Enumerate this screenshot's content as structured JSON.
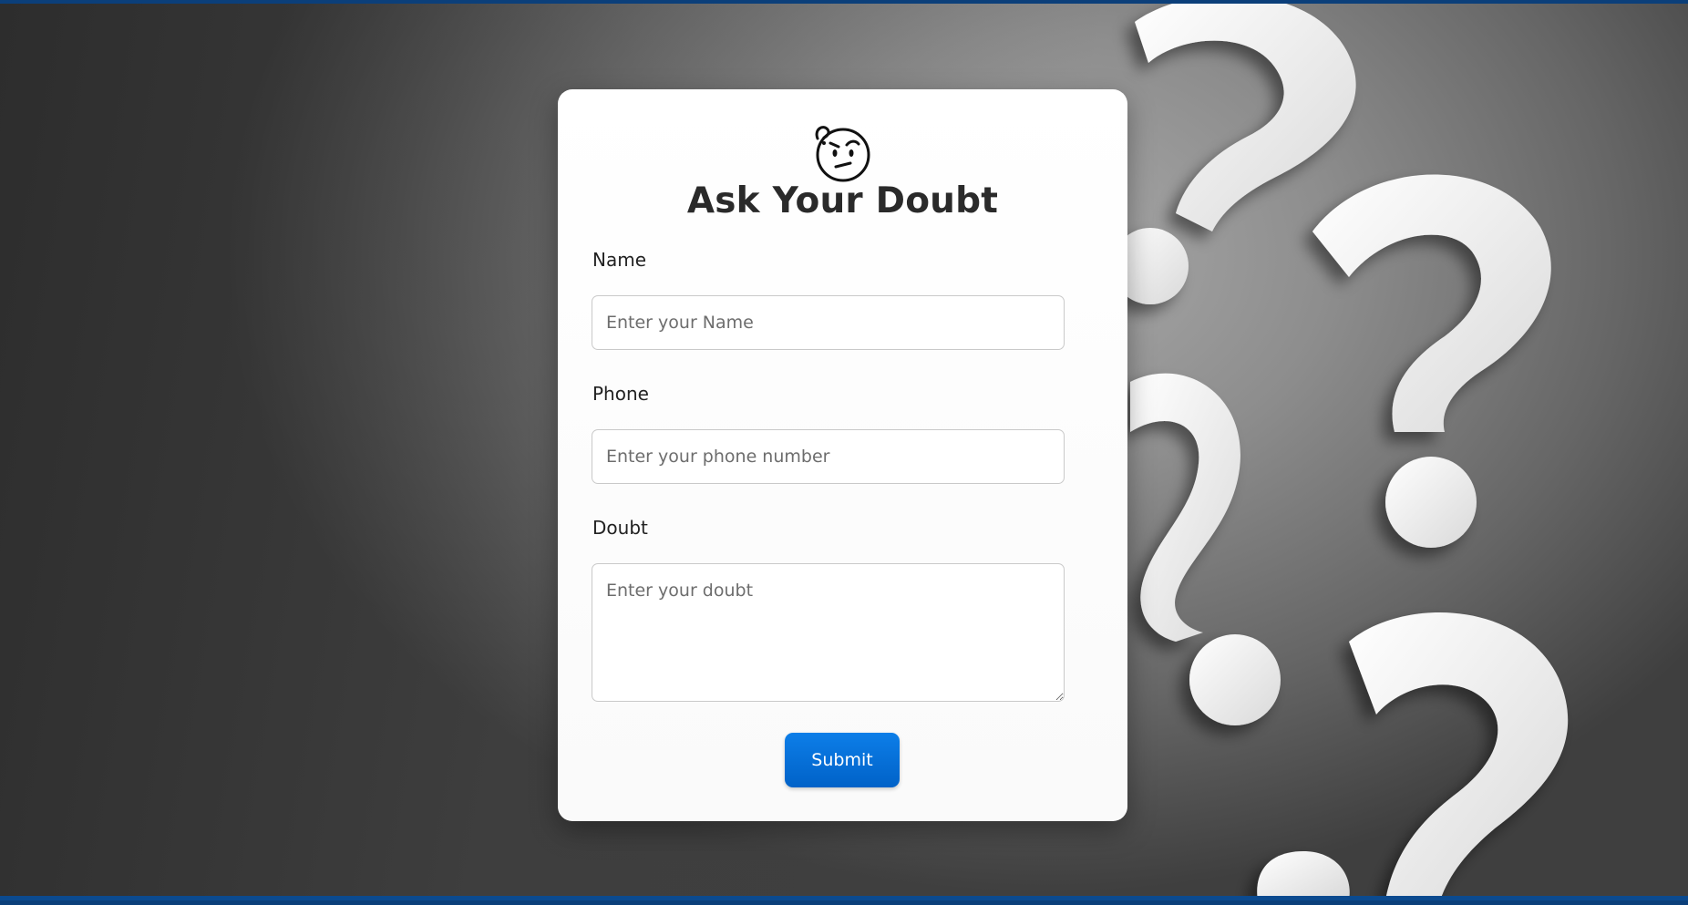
{
  "form": {
    "title": "Ask Your Doubt",
    "icon": "thinking-face-icon",
    "fields": {
      "name": {
        "label": "Name",
        "placeholder": "Enter your Name",
        "value": ""
      },
      "phone": {
        "label": "Phone",
        "placeholder": "Enter your phone number",
        "value": ""
      },
      "doubt": {
        "label": "Doubt",
        "placeholder": "Enter your doubt",
        "value": ""
      }
    },
    "submit_label": "Submit"
  },
  "colors": {
    "accent": "#0b6fd9",
    "frame": "#0b4a8f",
    "text": "#2a2a2a"
  },
  "background": {
    "decoration": "question-marks-icon"
  }
}
